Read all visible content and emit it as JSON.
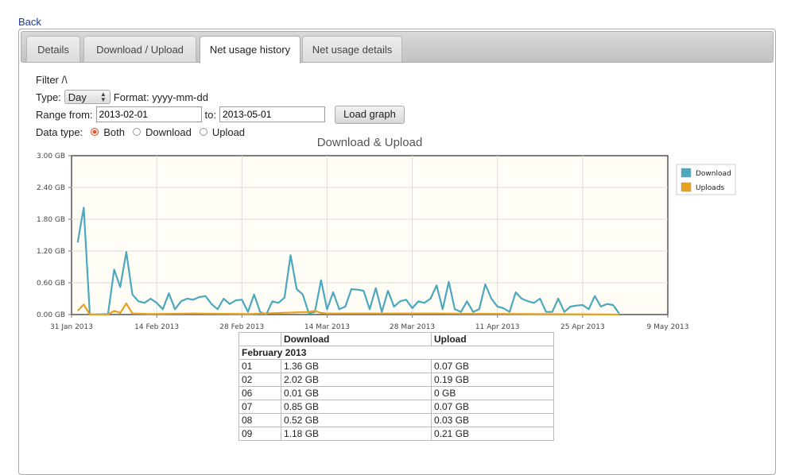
{
  "back_label": "Back",
  "tabs": [
    {
      "label": "Details",
      "active": false
    },
    {
      "label": "Download / Upload",
      "active": false
    },
    {
      "label": "Net usage history",
      "active": true
    },
    {
      "label": "Net usage details",
      "active": false
    }
  ],
  "filter": {
    "toggle_label": "Filter /\\",
    "type_label": "Type:",
    "type_value": "Day",
    "format_label": "Format: yyyy-mm-dd",
    "range_from_label": "Range from:",
    "range_from_value": "2013-02-01",
    "to_label": "to:",
    "to_value": "2013-05-01",
    "load_button": "Load graph",
    "data_type_label": "Data type:",
    "radio_options": [
      {
        "label": "Both",
        "checked": true
      },
      {
        "label": "Download",
        "checked": false
      },
      {
        "label": "Upload",
        "checked": false
      }
    ]
  },
  "chart_data": {
    "type": "line",
    "title": "Download & Upload",
    "xlabel": "",
    "ylabel": "",
    "ylim": [
      0,
      3.0
    ],
    "y_ticks": [
      "0.00 GB",
      "0.60 GB",
      "1.20 GB",
      "1.80 GB",
      "2.40 GB",
      "3.00 GB"
    ],
    "x_ticks": [
      "31 Jan 2013",
      "14 Feb 2013",
      "28 Feb 2013",
      "14 Mar 2013",
      "28 Mar 2013",
      "11 Apr 2013",
      "25 Apr 2013",
      "9 May 2013"
    ],
    "x_range": [
      "2013-01-31",
      "2013-05-09"
    ],
    "grid": true,
    "legend_position": "right",
    "series": [
      {
        "name": "Download",
        "color": "#4aa8bf",
        "x": [
          "2013-02-01",
          "2013-02-02",
          "2013-02-03",
          "2013-02-06",
          "2013-02-07",
          "2013-02-08",
          "2013-02-09",
          "2013-02-10",
          "2013-02-11",
          "2013-02-12",
          "2013-02-13",
          "2013-02-14",
          "2013-02-15",
          "2013-02-16",
          "2013-02-17",
          "2013-02-18",
          "2013-02-19",
          "2013-02-20",
          "2013-02-21",
          "2013-02-22",
          "2013-02-23",
          "2013-02-24",
          "2013-02-25",
          "2013-02-26",
          "2013-02-27",
          "2013-02-28",
          "2013-03-01",
          "2013-03-02",
          "2013-03-03",
          "2013-03-04",
          "2013-03-05",
          "2013-03-06",
          "2013-03-07",
          "2013-03-08",
          "2013-03-09",
          "2013-03-10",
          "2013-03-11",
          "2013-03-12",
          "2013-03-13",
          "2013-03-14",
          "2013-03-15",
          "2013-03-16",
          "2013-03-17",
          "2013-03-18",
          "2013-03-19",
          "2013-03-20",
          "2013-03-21",
          "2013-03-22",
          "2013-03-23",
          "2013-03-24",
          "2013-03-25",
          "2013-03-26",
          "2013-03-27",
          "2013-03-28",
          "2013-03-29",
          "2013-03-30",
          "2013-03-31",
          "2013-04-01",
          "2013-04-02",
          "2013-04-03",
          "2013-04-04",
          "2013-04-05",
          "2013-04-06",
          "2013-04-07",
          "2013-04-08",
          "2013-04-09",
          "2013-04-10",
          "2013-04-11",
          "2013-04-12",
          "2013-04-13",
          "2013-04-14",
          "2013-04-15",
          "2013-04-16",
          "2013-04-17",
          "2013-04-18",
          "2013-04-19",
          "2013-04-20",
          "2013-04-21",
          "2013-04-22",
          "2013-04-23",
          "2013-04-24",
          "2013-04-25",
          "2013-04-26",
          "2013-04-27",
          "2013-04-28",
          "2013-04-29",
          "2013-04-30",
          "2013-05-01"
        ],
        "values": [
          1.36,
          2.02,
          0.0,
          0.01,
          0.85,
          0.52,
          1.18,
          0.38,
          0.25,
          0.22,
          0.3,
          0.22,
          0.1,
          0.4,
          0.1,
          0.25,
          0.3,
          0.28,
          0.33,
          0.35,
          0.2,
          0.1,
          0.3,
          0.2,
          0.27,
          0.28,
          0.05,
          0.38,
          0.05,
          0.0,
          0.25,
          0.22,
          0.32,
          1.12,
          0.48,
          0.38,
          0.02,
          0.05,
          0.65,
          0.1,
          0.42,
          0.1,
          0.15,
          0.48,
          0.47,
          0.45,
          0.1,
          0.5,
          0.05,
          0.45,
          0.15,
          0.25,
          0.28,
          0.12,
          0.25,
          0.22,
          0.3,
          0.55,
          0.1,
          0.62,
          0.1,
          0.05,
          0.25,
          0.05,
          0.1,
          0.57,
          0.3,
          0.15,
          0.12,
          0.05,
          0.42,
          0.3,
          0.25,
          0.22,
          0.3,
          0.05,
          0.05,
          0.3,
          0.05,
          0.15,
          0.17,
          0.18,
          0.1,
          0.35,
          0.15,
          0.2,
          0.18,
          0.02
        ]
      },
      {
        "name": "Uploads",
        "color": "#e8a020",
        "x": [
          "2013-02-01",
          "2013-02-02",
          "2013-02-03",
          "2013-02-06",
          "2013-02-07",
          "2013-02-08",
          "2013-02-09",
          "2013-02-10",
          "2013-02-13",
          "2013-02-20",
          "2013-03-01",
          "2013-03-11",
          "2013-03-12",
          "2013-03-13",
          "2013-03-14",
          "2013-03-20",
          "2013-04-01",
          "2013-05-01"
        ],
        "values": [
          0.07,
          0.19,
          0.0,
          0.0,
          0.07,
          0.03,
          0.21,
          0.02,
          0.01,
          0.02,
          0.01,
          0.05,
          0.07,
          0.03,
          0.02,
          0.02,
          0.02,
          0.0
        ]
      }
    ]
  },
  "table": {
    "headers": [
      "",
      "Download",
      "Upload"
    ],
    "month": "February 2013",
    "rows": [
      [
        "01",
        "1.36 GB",
        "0.07 GB"
      ],
      [
        "02",
        "2.02 GB",
        "0.19 GB"
      ],
      [
        "06",
        "0.01 GB",
        "0 GB"
      ],
      [
        "07",
        "0.85 GB",
        "0.07 GB"
      ],
      [
        "08",
        "0.52 GB",
        "0.03 GB"
      ],
      [
        "09",
        "1.18 GB",
        "0.21 GB"
      ]
    ]
  }
}
